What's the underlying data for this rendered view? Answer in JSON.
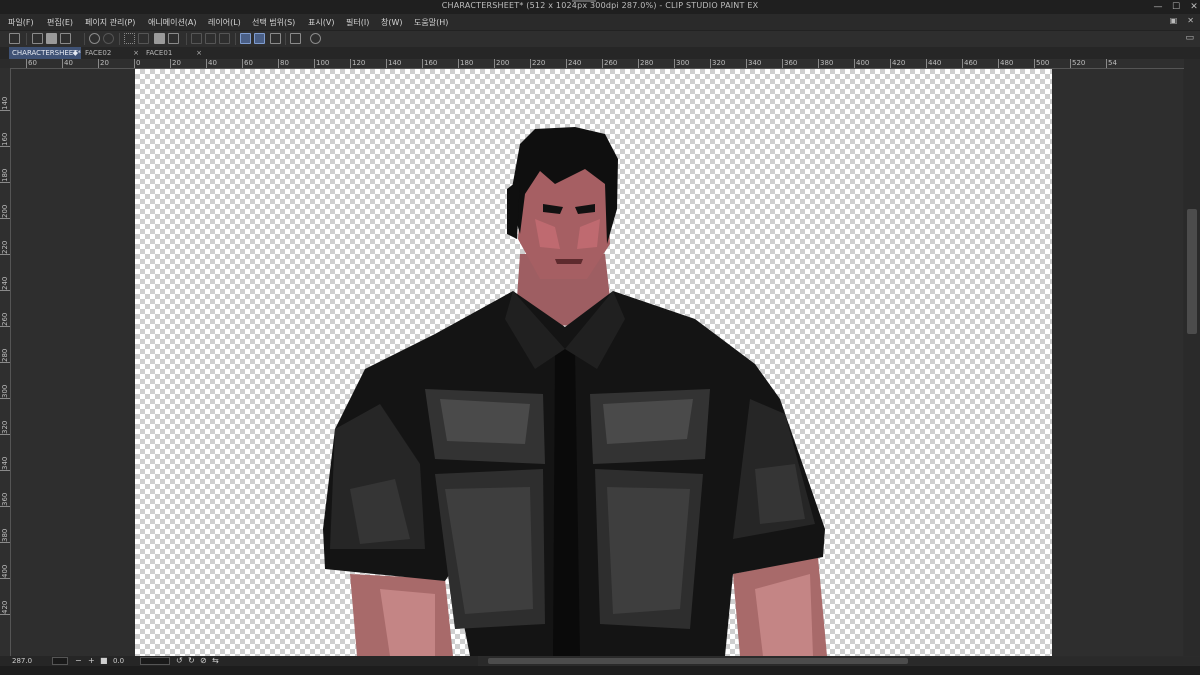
{
  "window": {
    "title": "CHARACTERSHEET* (512 x 1024px 300dpi 287.0%) - CLIP STUDIO PAINT EX",
    "minimize_icon": "minimize-icon",
    "maximize_icon": "maximize-icon",
    "close_icon": "close-icon"
  },
  "menu": [
    "파일(F)",
    "편집(E)",
    "페이지 관리(P)",
    "애니메이션(A)",
    "레이어(L)",
    "선택 범위(S)",
    "표시(V)",
    "필터(I)",
    "창(W)",
    "도움말(H)"
  ],
  "tabs": [
    {
      "label": "CHARACTERSHEET*",
      "active": true,
      "marker": "◆"
    },
    {
      "label": "FACE02",
      "active": false,
      "marker": "×"
    },
    {
      "label": "FACE01",
      "active": false,
      "marker": "×"
    }
  ],
  "ruler_h": [
    "60",
    "40",
    "20",
    "0",
    "20",
    "40",
    "60",
    "80",
    "100",
    "120",
    "140",
    "160",
    "180",
    "200",
    "220",
    "240",
    "260",
    "280",
    "300",
    "320",
    "340",
    "360",
    "380",
    "400",
    "420",
    "440",
    "460",
    "480",
    "500",
    "520",
    "54"
  ],
  "ruler_v": [
    "140",
    "160",
    "180",
    "200",
    "220",
    "240",
    "260",
    "280",
    "300",
    "320",
    "340",
    "360",
    "380",
    "400",
    "420"
  ],
  "status": {
    "zoom": "287.0",
    "rotation": "0.0"
  },
  "colors": {
    "accent": "#3f5275",
    "canvas_checker": "#cfcfcf",
    "workspace": "#2e2e2e"
  },
  "icons": {
    "toolbar": [
      "cs-logo-icon",
      "new-icon",
      "open-icon",
      "save-icon",
      "undo-icon",
      "redo-icon",
      "lasso-icon",
      "deselect-icon",
      "fill-icon",
      "transform-icon",
      "snap-ruler-icon",
      "snap-grid-icon",
      "snap-special-icon",
      "ruler-icon",
      "draw-line-icon",
      "contour-icon",
      "color-picker-icon",
      "settings-icon"
    ]
  }
}
